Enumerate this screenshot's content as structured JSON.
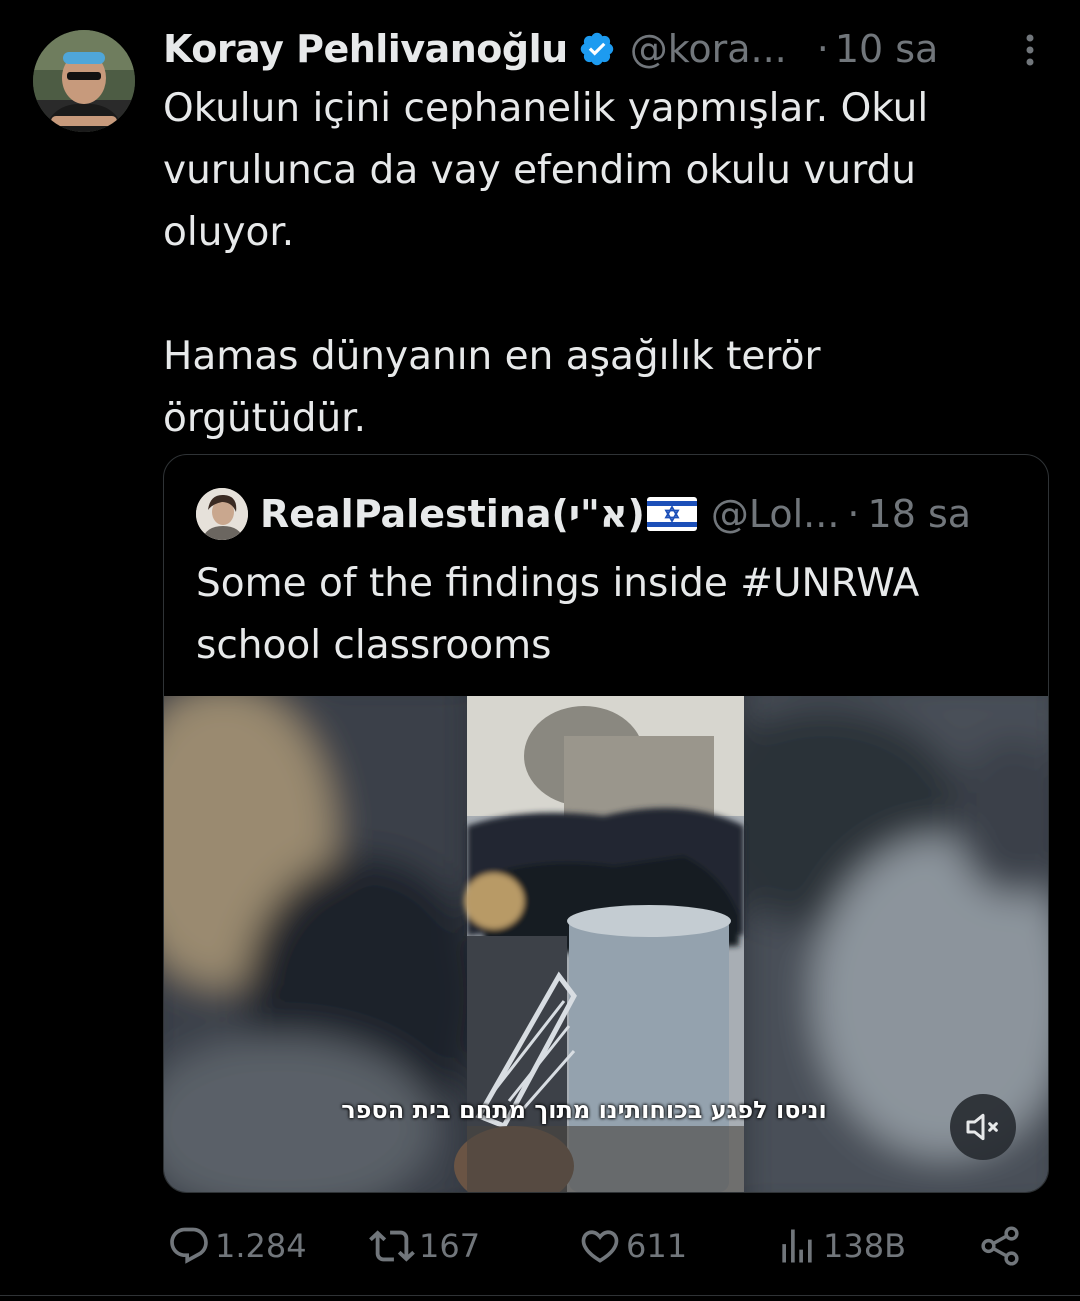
{
  "tweet": {
    "author_name": "Koray Pehlivanoğlu",
    "author_handle": "@kora...",
    "separator": "·",
    "time": "10 sa",
    "text": "Okulun içini cephanelik yapmışlar. Okul\nvurulunca da vay efendim okulu vurdu\noluyor.\n\nHamas dünyanın en aşağılık terör\nörgütüdür."
  },
  "quoted": {
    "author_name": "RealPalestina(א\"י)",
    "author_handle": "@Lol...",
    "separator": "·",
    "time": "18 sa",
    "text": "Some of the findings inside #UNRWA school classrooms",
    "video_subtitle": "וניסו לפגע בכוחותינו מתוך מתחם בית הספר"
  },
  "actions": {
    "replies": "1.284",
    "reposts": "167",
    "likes": "611",
    "views": "138B"
  },
  "colors": {
    "background": "#000000",
    "text": "#e7e9ea",
    "muted": "#71767b",
    "verified": "#1d9bf0",
    "border": "#2f3336"
  },
  "icons": {
    "verified": "verified-badge-icon",
    "more": "more-dots-icon",
    "reply": "reply-icon",
    "repost": "repost-icon",
    "like": "heart-icon",
    "views": "views-chart-icon",
    "share": "share-icon",
    "mute": "muted-speaker-icon"
  }
}
